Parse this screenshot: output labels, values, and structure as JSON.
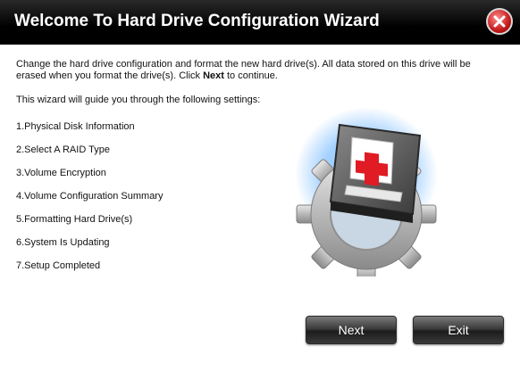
{
  "window": {
    "title": "Welcome To Hard Drive Configuration Wizard",
    "close_icon": "close-icon"
  },
  "intro": {
    "text_before": "Change the hard drive configuration and format the new hard drive(s). All data stored on this drive will be erased when you format the drive(s). Click ",
    "bold": "Next",
    "text_after": " to continue.",
    "guide": "This wizard will guide you through the following settings:"
  },
  "steps": [
    "1.Physical Disk Information",
    "2.Select A RAID Type",
    "3.Volume Encryption",
    "4.Volume Configuration Summary",
    "5.Formatting Hard Drive(s)",
    "6.System Is Updating",
    "7.Setup Completed"
  ],
  "illustration": {
    "icon": "hard-drive-gear-icon",
    "colors": {
      "accent_glow": "#4aa3ff",
      "cross": "#e01b24"
    }
  },
  "buttons": {
    "next": "Next",
    "exit": "Exit"
  }
}
